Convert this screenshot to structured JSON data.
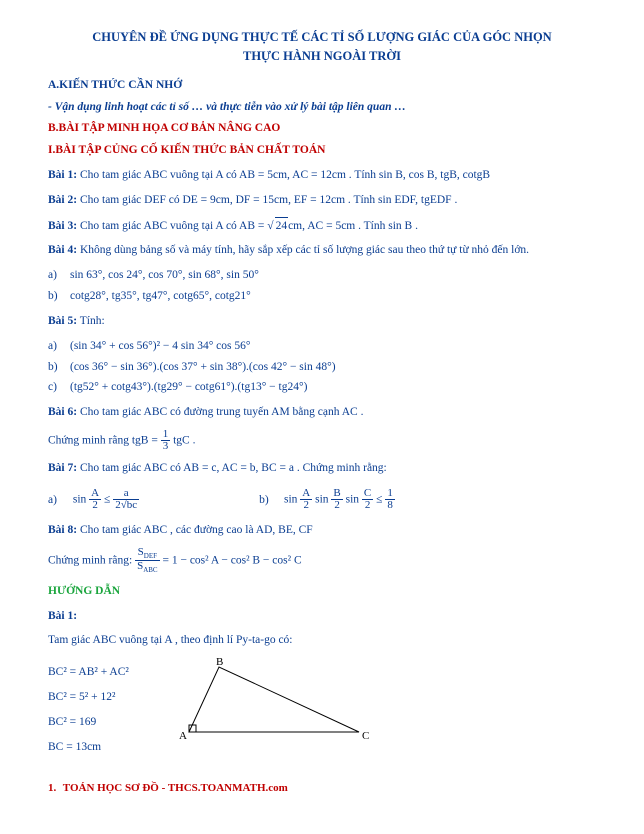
{
  "title1": "CHUYÊN ĐỀ ỨNG DỤNG THỰC TẾ CÁC TỈ SỐ LƯỢNG GIÁC CỦA GÓC NHỌN",
  "title2": "THỰC HÀNH NGOÀI TRỜI",
  "secA": "A.KIẾN THỨC CẦN NHỚ",
  "note": "- Vận dụng linh hoạt các tỉ số … và thực tiễn vào xử lý bài tập liên quan …",
  "secB": "B.BÀI TẬP MINH HỌA CƠ BẢN NÂNG CAO",
  "secI": "I.BÀI TẬP CỦNG CỐ KIẾN THỨC BẢN CHẤT TOÁN",
  "b1": {
    "label": "Bài 1:",
    "text": " Cho tam giác ABC  vuông tại A  có AB = 5cm, AC = 12cm . Tính  sin B, cos B, tgB, cotgB"
  },
  "b2": {
    "label": "Bài 2:",
    "text": " Cho tam giác DEF  có DE = 9cm, DF = 15cm, EF = 12cm . Tính  sin EDF, tgEDF ."
  },
  "b3": {
    "label": "Bài 3:",
    "pre": " Cho tam giác ABC  vuông tại A  có AB = ",
    "sq": "24",
    "post": "cm, AC = 5cm . Tính  sin B ."
  },
  "b4": {
    "label": "Bài 4:",
    "text": " Không dùng bảng số và máy tính, hãy sắp xếp các tỉ số lượng giác sau theo thứ tự từ nhỏ đến lớn."
  },
  "b4a": "sin 63°, cos 24°, cos 70°, sin 68°, sin 50°",
  "b4b": "cotg28°, tg35°, tg47°, cotg65°, cotg21°",
  "b5": {
    "label": "Bài 5:",
    "text": " Tính:"
  },
  "b5a": "(sin 34° + cos 56°)² − 4 sin 34° cos 56°",
  "b5b": "(cos 36° − sin 36°).(cos 37° + sin 38°).(cos 42° − sin 48°)",
  "b5c": "(tg52° + cotg43°).(tg29° − cotg61°).(tg13° − tg24°)",
  "b6": {
    "label": "Bài 6:",
    "text": " Cho tam giác ABC  có đường trung tuyến AM  bằng cạnh AC ."
  },
  "b6proof": "Chứng minh rằng  tgB = ",
  "b6frac": {
    "n": "1",
    "d": "3"
  },
  "b6tail": " tgC .",
  "b7": {
    "label": "Bài 7:",
    "text": " Cho tam giác ABC  có AB = c, AC = b, BC = a . Chứng minh rằng:"
  },
  "b7aL": "sin",
  "b7aFrac": {
    "n": "A",
    "d": "2"
  },
  "b7aMid": " ≤ ",
  "b7aR": {
    "n": "a",
    "d": "2√bc"
  },
  "b7bL": "sin",
  "b7bF1": {
    "n": "A",
    "d": "2"
  },
  "b7bS": "sin",
  "b7bF2": {
    "n": "B",
    "d": "2"
  },
  "b7bS2": "sin",
  "b7bF3": {
    "n": "C",
    "d": "2"
  },
  "b7bMid": " ≤ ",
  "b7bR": {
    "n": "1",
    "d": "8"
  },
  "b8": {
    "label": "Bài 8:",
    "text": " Cho tam giác ABC , các đường cao là AD, BE, CF"
  },
  "b8proof": "Chứng minh rằng: ",
  "b8frac": {
    "n": "S",
    "d": "S"
  },
  "b8sub1": "DEF",
  "b8sub2": "ABC",
  "b8tail": " = 1 − cos² A − cos² B − cos² C",
  "hd": "HƯỚNG DẪN",
  "hd1": "Bài 1:",
  "hd1text": "Tam giác ABC  vuông tại A , theo định lí Py-ta-go có:",
  "eq1": "BC² = AB² + AC²",
  "eq2": "BC² = 5² + 12²",
  "eq3": "BC² = 169",
  "eq4": "BC = 13cm",
  "tri": {
    "A": "A",
    "B": "B",
    "C": "C"
  },
  "footerPage": "1.",
  "footerText": " TOÁN HỌC SƠ ĐỒ - THCS.TOANMATH.com",
  "la": "a)",
  "lb": "b)",
  "lc": "c)",
  "chart_data": {
    "type": "table",
    "title": "Worked example values (Bài 1)",
    "series": [
      {
        "name": "AB",
        "value": 5,
        "unit": "cm"
      },
      {
        "name": "AC",
        "value": 12,
        "unit": "cm"
      },
      {
        "name": "BC²",
        "value": 169
      },
      {
        "name": "BC",
        "value": 13,
        "unit": "cm"
      }
    ]
  }
}
